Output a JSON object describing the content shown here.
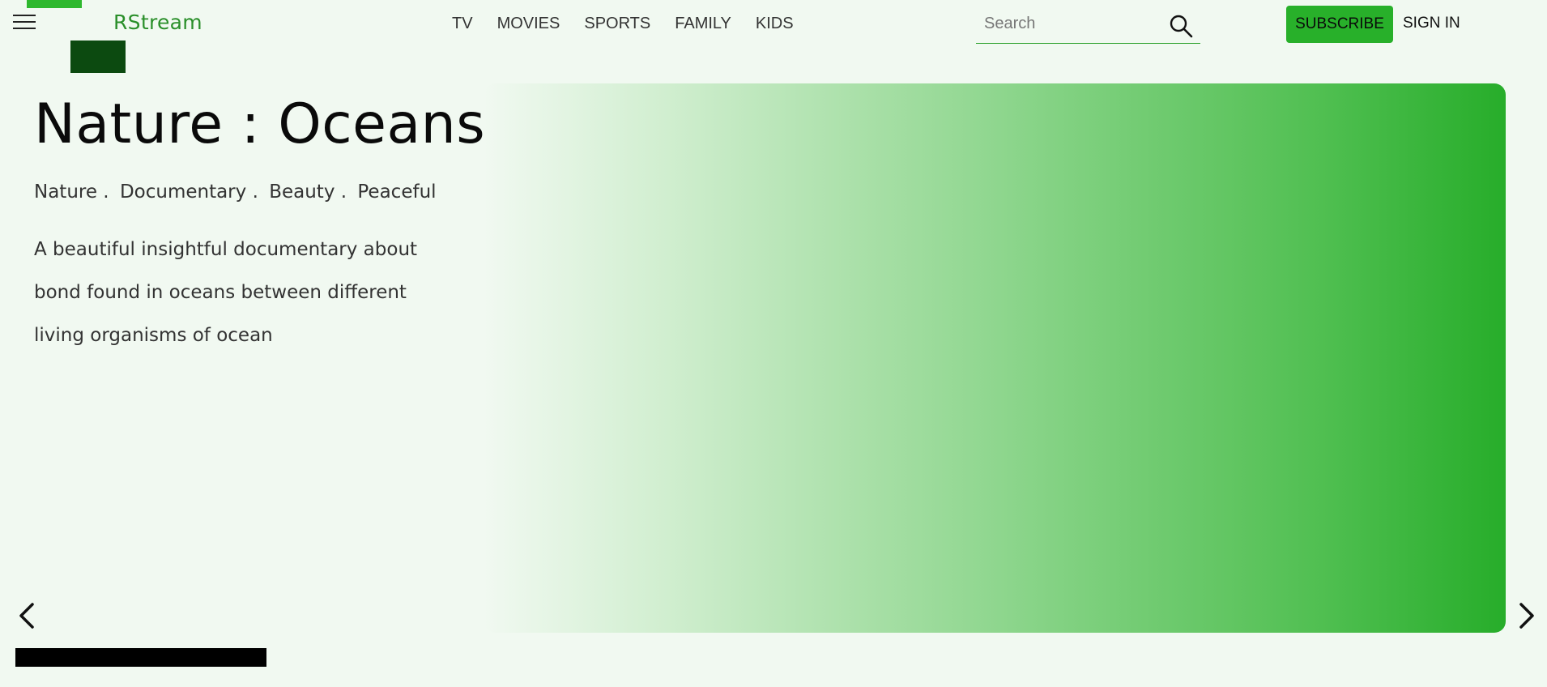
{
  "header": {
    "brand": "RStream",
    "nav": [
      "TV",
      "MOVIES",
      "SPORTS",
      "FAMILY",
      "KIDS"
    ],
    "search_placeholder": "Search",
    "subscribe_label": "SUBSCRIBE",
    "signin_label": "SIGN IN"
  },
  "hero": {
    "title": "Nature : Oceans",
    "tags": [
      "Nature .",
      "Documentary .",
      "Beauty .",
      "Peaceful"
    ],
    "description_lines": [
      "A beautiful insightful documentary about",
      "bond found in oceans between different",
      "living organisms of ocean"
    ]
  },
  "icons": {
    "menu": "hamburger-menu-icon",
    "search": "search-icon",
    "prev": "chevron-left-icon",
    "next": "chevron-right-icon"
  },
  "colors": {
    "accent": "#28b02a",
    "brand": "#2a8f2a",
    "logo_dark": "#0c4a10",
    "background": "#f1f9f1"
  }
}
